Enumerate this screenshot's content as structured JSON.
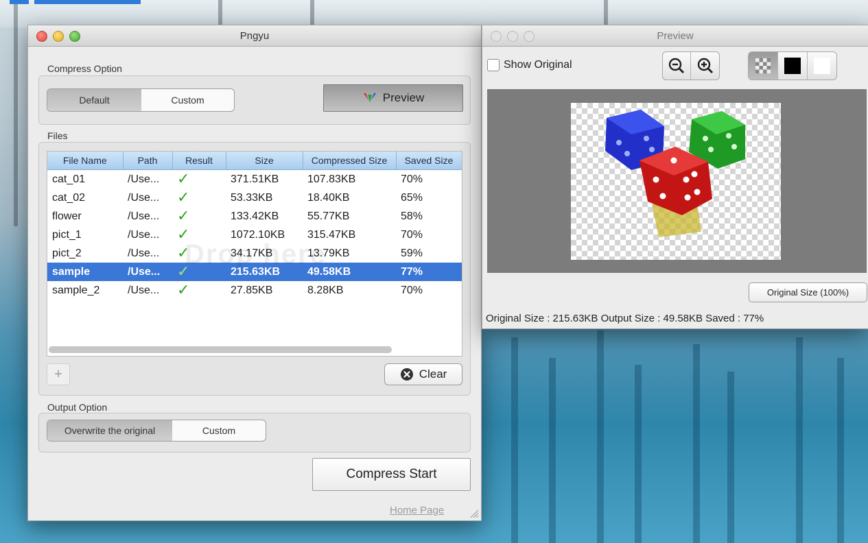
{
  "main_window": {
    "title": "Pngyu",
    "compress_option": {
      "label": "Compress Option",
      "tabs": [
        "Default",
        "Custom"
      ],
      "selected": "Default",
      "preview_button": "Preview"
    },
    "files": {
      "label": "Files",
      "columns": [
        "File Name",
        "Path",
        "Result",
        "Size",
        "Compressed Size",
        "Saved Size"
      ],
      "rows": [
        {
          "name": "cat_01",
          "path": "/Use...",
          "result": "✓",
          "size": "371.51KB",
          "compressed": "107.83KB",
          "saved": "70%"
        },
        {
          "name": "cat_02",
          "path": "/Use...",
          "result": "✓",
          "size": "53.33KB",
          "compressed": "18.40KB",
          "saved": "65%"
        },
        {
          "name": "flower",
          "path": "/Use...",
          "result": "✓",
          "size": "133.42KB",
          "compressed": "55.77KB",
          "saved": "58%"
        },
        {
          "name": "pict_1",
          "path": "/Use...",
          "result": "✓",
          "size": "1072.10KB",
          "compressed": "315.47KB",
          "saved": "70%"
        },
        {
          "name": "pict_2",
          "path": "/Use...",
          "result": "✓",
          "size": "34.17KB",
          "compressed": "13.79KB",
          "saved": "59%"
        },
        {
          "name": "sample",
          "path": "/Use...",
          "result": "✓",
          "size": "215.63KB",
          "compressed": "49.58KB",
          "saved": "77%"
        },
        {
          "name": "sample_2",
          "path": "/Use...",
          "result": "✓",
          "size": "27.85KB",
          "compressed": "8.28KB",
          "saved": "70%"
        }
      ],
      "selected_row": "sample",
      "drop_watermark": "Drop here",
      "add_button": "+",
      "clear_button": "Clear"
    },
    "output_option": {
      "label": "Output Option",
      "tabs": [
        "Overwrite the original",
        "Custom"
      ],
      "selected": "Overwrite the original"
    },
    "compress_start_button": "Compress Start",
    "home_page_link": "Home Page"
  },
  "preview_window": {
    "title": "Preview",
    "show_original_label": "Show Original",
    "show_original_checked": false,
    "zoom_buttons": [
      "zoom-out-icon",
      "zoom-in-icon"
    ],
    "background_options": [
      "checker-icon",
      "black-bg-icon",
      "white-bg-icon"
    ],
    "original_size_button": "Original Size (100%)",
    "status": "Original Size : 215.63KB Output Size :  49.58KB Saved :  77%"
  },
  "colors": {
    "selection": "#3b77d6",
    "check": "#2ea51d",
    "header": "#a9cdef"
  }
}
